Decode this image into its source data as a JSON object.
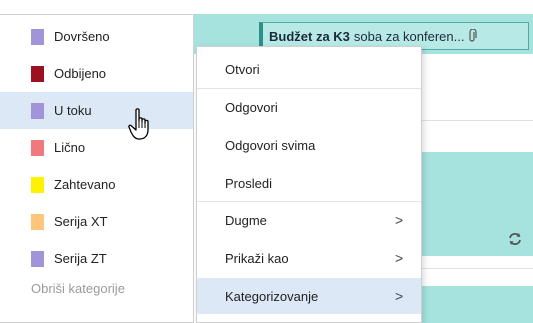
{
  "event": {
    "title_bold": "Budžet za K3",
    "title_rest": "soba za konferen...",
    "attachment_icon": "paperclip-icon"
  },
  "categories": {
    "items": [
      {
        "label": "Dovršeno",
        "color": "#a294d9"
      },
      {
        "label": "Odbijeno",
        "color": "#9b1120"
      },
      {
        "label": "U toku",
        "color": "#a294d9"
      },
      {
        "label": "Lično",
        "color": "#f0797e"
      },
      {
        "label": "Zahtevano",
        "color": "#fff200"
      },
      {
        "label": "Serija XT",
        "color": "#fdc67a"
      },
      {
        "label": "Serija ZT",
        "color": "#a294d9"
      }
    ],
    "clear_label": "Obriši kategorije",
    "hovered": "U toku"
  },
  "context_menu": {
    "items": [
      {
        "label": "Otvori"
      },
      {
        "label": "Odgovori"
      },
      {
        "label": "Odgovori svima"
      },
      {
        "label": "Prosledi"
      },
      {
        "label": "Dugme",
        "submenu": true
      },
      {
        "label": "Prikaži kao",
        "submenu": true
      },
      {
        "label": "Kategorizovanje",
        "submenu": true
      }
    ],
    "chevron": ">",
    "hovered": "Kategorizovanje"
  },
  "colors": {
    "event_bg": "#a6e3df",
    "hover_bg": "#dce8f5"
  }
}
